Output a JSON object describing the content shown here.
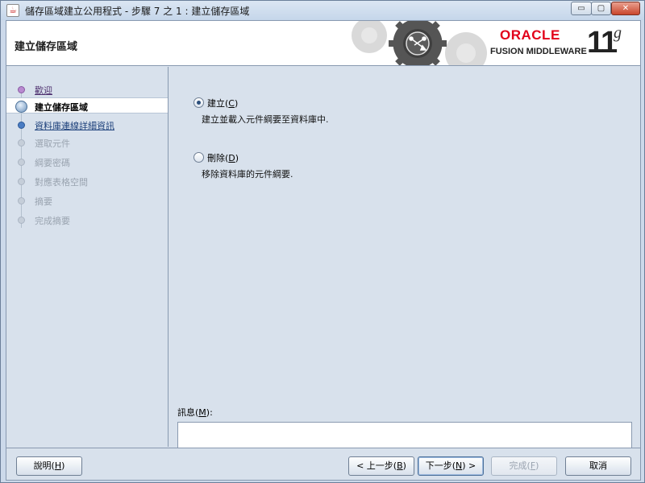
{
  "window": {
    "title": "儲存區域建立公用程式 - 步驟 7 之 1 : 建立儲存區域",
    "minimize_glyph": "▭",
    "maximize_glyph": "▢",
    "close_glyph": "✕"
  },
  "header": {
    "title": "建立儲存區域",
    "brand": "ORACLE",
    "product": "FUSION MIDDLEWARE",
    "version": "11",
    "version_suffix": "g"
  },
  "steps": [
    {
      "label": "歡迎",
      "state": "visited"
    },
    {
      "label": "建立儲存區域",
      "state": "current"
    },
    {
      "label": "資料庫連線詳細資訊",
      "state": "next"
    },
    {
      "label": "選取元件",
      "state": "disabled"
    },
    {
      "label": "綱要密碼",
      "state": "disabled"
    },
    {
      "label": "對應表格空間",
      "state": "disabled"
    },
    {
      "label": "摘要",
      "state": "disabled"
    },
    {
      "label": "完成摘要",
      "state": "disabled"
    }
  ],
  "options": {
    "create": {
      "label_prefix": "建立(",
      "mnemonic": "C",
      "label_suffix": ")",
      "description": "建立並載入元件綱要至資料庫中.",
      "selected": true
    },
    "drop": {
      "label_prefix": "刪除(",
      "mnemonic": "D",
      "label_suffix": ")",
      "description": "移除資料庫的元件綱要.",
      "selected": false
    }
  },
  "messages": {
    "label_prefix": "訊息(",
    "mnemonic": "M",
    "label_suffix": "):",
    "value": ""
  },
  "buttons": {
    "help": {
      "prefix": "說明(",
      "mnemonic": "H",
      "suffix": ")"
    },
    "back": {
      "prefix": "< 上一步(",
      "mnemonic": "B",
      "suffix": ")"
    },
    "next": {
      "prefix": "下一步(",
      "mnemonic": "N",
      "suffix": ") >"
    },
    "finish": {
      "prefix": "完成(",
      "mnemonic": "F",
      "suffix": ")"
    },
    "cancel": {
      "label": "取消"
    }
  },
  "colors": {
    "oracle_red": "#e2001a",
    "panel_bg": "#d8e1ec",
    "visited_step": "#b98ad0",
    "next_step": "#4a7cc3"
  }
}
